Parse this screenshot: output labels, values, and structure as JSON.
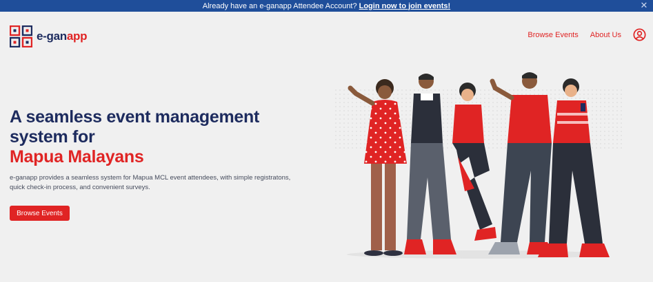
{
  "announcement": {
    "text": "Already have an e-ganapp Attendee Account?",
    "link": "Login now to join events!",
    "close_glyph": "✕"
  },
  "brand": {
    "name_prefix": "e-gan",
    "name_suffix": "app"
  },
  "nav": {
    "items": [
      {
        "label": "Browse Events"
      },
      {
        "label": "About Us"
      }
    ],
    "user_icon": "user-circle-icon"
  },
  "hero": {
    "title_line1": "A seamless event management system for",
    "title_highlight": "Mapua Malayans",
    "description": "e-ganapp provides a seamless system for Mapua MCL event attendees, with simple registratons, quick check-in process, and convenient surveys.",
    "cta_label": "Browse Events"
  },
  "colors": {
    "brand_red": "#e02424",
    "brand_navy": "#1d2b5e",
    "announcement_bg": "#1f4e9a",
    "page_bg": "#f0f0f0"
  }
}
